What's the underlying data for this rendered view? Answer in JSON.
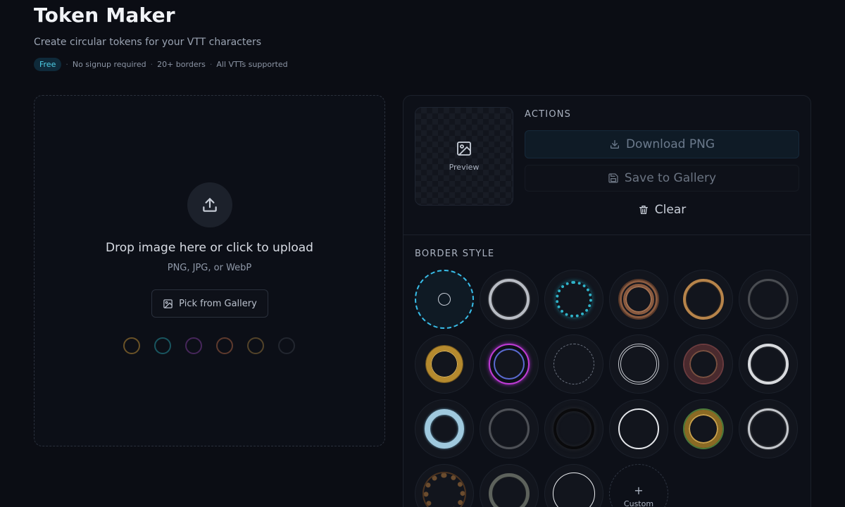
{
  "header": {
    "title": "Token Maker",
    "subtitle": "Create circular tokens for your VTT characters",
    "tags": [
      "Free",
      "No signup required",
      "20+ borders",
      "All VTTs supported"
    ]
  },
  "dropzone": {
    "title": "Drop image here or click to upload",
    "formats": "PNG, JPG, or WebP",
    "gallery_button": "Pick from Gallery",
    "mini_rings": [
      "#8a6a2e",
      "#1d6e78",
      "#5a2f72",
      "#7a4a36",
      "#6b5630",
      "#2a2f38"
    ]
  },
  "preview": {
    "label": "Preview"
  },
  "actions": {
    "heading": "ACTIONS",
    "download": "Download PNG",
    "save": "Save to Gallery",
    "clear": "Clear"
  },
  "borders": {
    "heading": "BORDER STYLE",
    "custom_label": "Custom",
    "custom_plus": "+",
    "styles": [
      {
        "name": "none",
        "selected": true
      },
      {
        "name": "silver-thick"
      },
      {
        "name": "runic-cyan"
      },
      {
        "name": "thorns"
      },
      {
        "name": "bronze"
      },
      {
        "name": "steel-dark"
      },
      {
        "name": "gold-braided"
      },
      {
        "name": "neon-tech"
      },
      {
        "name": "dashed"
      },
      {
        "name": "double-thin"
      },
      {
        "name": "dark-ornate"
      },
      {
        "name": "white-thick"
      },
      {
        "name": "ice"
      },
      {
        "name": "iron"
      },
      {
        "name": "shadow"
      },
      {
        "name": "white-thin"
      },
      {
        "name": "jeweled-gold"
      },
      {
        "name": "platinum"
      },
      {
        "name": "vines"
      },
      {
        "name": "stone"
      },
      {
        "name": "white-line"
      }
    ]
  }
}
